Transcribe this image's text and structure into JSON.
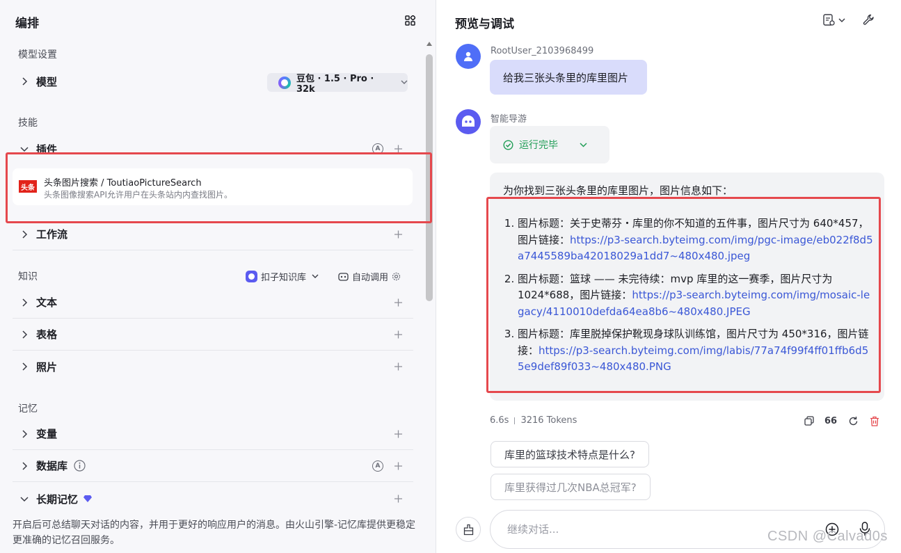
{
  "left": {
    "title": "编排",
    "model_section": {
      "label": "模型设置",
      "model_row": "模型",
      "model_name": "豆包 · 1.5 · Pro · 32k"
    },
    "skills_section": {
      "label": "技能",
      "plugins_row": "插件",
      "plugin": {
        "logo_text": "头条",
        "name": "头条图片搜索 / ToutiaoPictureSearch",
        "description": "头条图像搜索API允许用户在头条站内内查找图片。"
      },
      "workflow_row": "工作流"
    },
    "knowledge_section": {
      "label": "知识",
      "kb_select": "扣子知识库",
      "auto_call": "自动调用",
      "rows": [
        "文本",
        "表格",
        "照片"
      ]
    },
    "memory_section": {
      "label": "记忆",
      "variables_row": "变量",
      "database_row": "数据库",
      "long_term_row": "长期记忆",
      "description": "开启后可总结聊天对话的内容，并用于更好的响应用户的消息。由火山引擎-记忆库提供更稳定更准确的记忆召回服务。"
    },
    "icon_letter": "A"
  },
  "right": {
    "title": "预览与调试",
    "user": {
      "name": "RootUser_2103968499",
      "message": "给我三张头条里的库里图片"
    },
    "bot": {
      "name": "智能导游",
      "status": "运行完毕",
      "intro": "为你找到三张头条里的库里图片，图片信息如下：",
      "items": [
        {
          "text": "图片标题：关于史蒂芬・库里的你不知道的五件事，图片尺寸为 640*457，图片链接：",
          "link": "https://p3-search.byteimg.com/img/pgc-image/eb022f8d5a7445589ba42018029a1dd7~480x480.jpeg"
        },
        {
          "text": "图片标题：篮球 —— 未完待续：mvp 库里的这一赛季，图片尺寸为 1024*688，图片链接：",
          "link": "https://p3-search.byteimg.com/img/mosaic-legacy/4110010defda64ea8b6~480x480.JPEG"
        },
        {
          "text": "图片标题：库里脱掉保护靴现身球队训练馆，图片尺寸为 450*316，图片链接：",
          "link": "https://p3-search.byteimg.com/img/labis/77a74f99f4ff01ffb6d55e9def89f033~480x480.PNG"
        }
      ],
      "time": "6.6s",
      "tokens": "3216 Tokens",
      "quote_label": "66"
    },
    "suggestions": [
      "库里的篮球技术特点是什么?",
      "库里获得过几次NBA总冠军?"
    ],
    "input_placeholder": "继续对话...",
    "watermark": "CSDN @Calvad0s"
  },
  "colors": {
    "accent": "#4f6ef7",
    "highlight_box": "#e5484d",
    "success": "#1f9d55",
    "link": "#3a57d6",
    "danger": "#e5484d"
  }
}
